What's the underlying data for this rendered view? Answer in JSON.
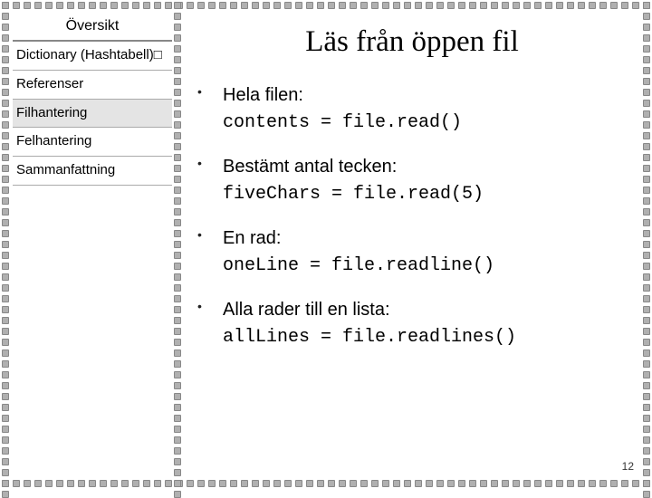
{
  "sidebar": {
    "title": "Översikt",
    "items": [
      {
        "label": "Dictionary (Hashtabell)□",
        "active": false
      },
      {
        "label": "Referenser",
        "active": false
      },
      {
        "label": "Filhantering",
        "active": true
      },
      {
        "label": "Felhantering",
        "active": false
      },
      {
        "label": "Sammanfattning",
        "active": false
      }
    ]
  },
  "main": {
    "title": "Läs från öppen fil",
    "bullets": [
      {
        "text": "Hela filen:",
        "code": "contents = file.read()"
      },
      {
        "text": "Bestämt antal tecken:",
        "code": "fiveChars = file.read(5)"
      },
      {
        "text": "En rad:",
        "code": "oneLine = file.readline()"
      },
      {
        "text": "Alla rader till en lista:",
        "code": "allLines = file.readlines()"
      }
    ]
  },
  "page_number": "12"
}
